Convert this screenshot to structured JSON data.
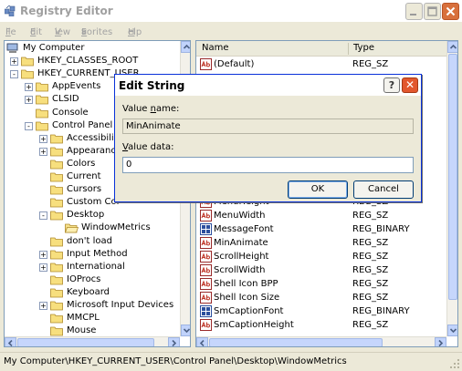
{
  "window": {
    "title": "Registry Editor"
  },
  "menu": [
    {
      "pre": "",
      "key": "F",
      "post": "ile"
    },
    {
      "pre": "",
      "key": "E",
      "post": "dit"
    },
    {
      "pre": "",
      "key": "V",
      "post": "iew"
    },
    {
      "pre": "F",
      "key": "a",
      "post": "vorites"
    },
    {
      "pre": "",
      "key": "H",
      "post": "elp"
    }
  ],
  "tree": {
    "items": [
      {
        "label": "My Computer",
        "depth": 0,
        "toggle": "",
        "icon": "computer-icon"
      },
      {
        "label": "HKEY_CLASSES_ROOT",
        "depth": 1,
        "toggle": "+",
        "icon": "folder-icon"
      },
      {
        "label": "HKEY_CURRENT_USER",
        "depth": 1,
        "toggle": "-",
        "icon": "folder-icon"
      },
      {
        "label": "AppEvents",
        "depth": 2,
        "toggle": "+",
        "icon": "folder-icon"
      },
      {
        "label": "CLSID",
        "depth": 2,
        "toggle": "+",
        "icon": "folder-icon"
      },
      {
        "label": "Console",
        "depth": 2,
        "toggle": "",
        "icon": "folder-icon"
      },
      {
        "label": "Control Panel",
        "depth": 2,
        "toggle": "-",
        "icon": "folder-icon"
      },
      {
        "label": "Accessibility",
        "depth": 3,
        "toggle": "+",
        "icon": "folder-icon"
      },
      {
        "label": "Appearance",
        "depth": 3,
        "toggle": "+",
        "icon": "folder-icon"
      },
      {
        "label": "Colors",
        "depth": 3,
        "toggle": "",
        "icon": "folder-icon"
      },
      {
        "label": "Current",
        "depth": 3,
        "toggle": "",
        "icon": "folder-icon"
      },
      {
        "label": "Cursors",
        "depth": 3,
        "toggle": "",
        "icon": "folder-icon"
      },
      {
        "label": "Custom Col",
        "depth": 3,
        "toggle": "",
        "icon": "folder-icon"
      },
      {
        "label": "Desktop",
        "depth": 3,
        "toggle": "-",
        "icon": "folder-icon"
      },
      {
        "label": "WindowMetrics",
        "depth": 4,
        "toggle": "",
        "icon": "open-folder-icon"
      },
      {
        "label": "don't load",
        "depth": 3,
        "toggle": "",
        "icon": "folder-icon"
      },
      {
        "label": "Input Method",
        "depth": 3,
        "toggle": "+",
        "icon": "folder-icon"
      },
      {
        "label": "International",
        "depth": 3,
        "toggle": "+",
        "icon": "folder-icon"
      },
      {
        "label": "IOProcs",
        "depth": 3,
        "toggle": "",
        "icon": "folder-icon"
      },
      {
        "label": "Keyboard",
        "depth": 3,
        "toggle": "",
        "icon": "folder-icon"
      },
      {
        "label": "Microsoft Input Devices",
        "depth": 3,
        "toggle": "+",
        "icon": "folder-icon"
      },
      {
        "label": "MMCPL",
        "depth": 3,
        "toggle": "",
        "icon": "folder-icon"
      },
      {
        "label": "Mouse",
        "depth": 3,
        "toggle": "",
        "icon": "folder-icon"
      }
    ]
  },
  "list": {
    "columns": {
      "name": "Name",
      "type": "Type"
    },
    "rows": [
      {
        "name": "(Default)",
        "type": "REG_SZ",
        "icon": "string-value-icon"
      },
      {
        "name": "MenuHeight",
        "type": "REG_SZ",
        "icon": "string-value-icon"
      },
      {
        "name": "MenuWidth",
        "type": "REG_SZ",
        "icon": "string-value-icon"
      },
      {
        "name": "MessageFont",
        "type": "REG_BINARY",
        "icon": "binary-value-icon"
      },
      {
        "name": "MinAnimate",
        "type": "REG_SZ",
        "icon": "string-value-icon"
      },
      {
        "name": "ScrollHeight",
        "type": "REG_SZ",
        "icon": "string-value-icon"
      },
      {
        "name": "ScrollWidth",
        "type": "REG_SZ",
        "icon": "string-value-icon"
      },
      {
        "name": "Shell Icon BPP",
        "type": "REG_SZ",
        "icon": "string-value-icon"
      },
      {
        "name": "Shell Icon Size",
        "type": "REG_SZ",
        "icon": "string-value-icon"
      },
      {
        "name": "SmCaptionFont",
        "type": "REG_BINARY",
        "icon": "binary-value-icon"
      },
      {
        "name": "SmCaptionHeight",
        "type": "REG_SZ",
        "icon": "string-value-icon"
      }
    ]
  },
  "status": {
    "path": "My Computer\\HKEY_CURRENT_USER\\Control Panel\\Desktop\\WindowMetrics"
  },
  "dialog": {
    "title": "Edit String",
    "help_glyph": "?",
    "close_glyph": "✕",
    "value_name_pre": "Value ",
    "value_name_key": "n",
    "value_name_post": "ame:",
    "value_name": "MinAnimate",
    "value_data_key": "V",
    "value_data_post": "alue data:",
    "value_data": "0",
    "ok_label": "OK",
    "cancel_label": "Cancel"
  },
  "colors": {
    "pane_border": "#7f9db9",
    "dialog_border": "#0831d9",
    "close_button": "#e2572d",
    "face": "#ece9d8"
  }
}
